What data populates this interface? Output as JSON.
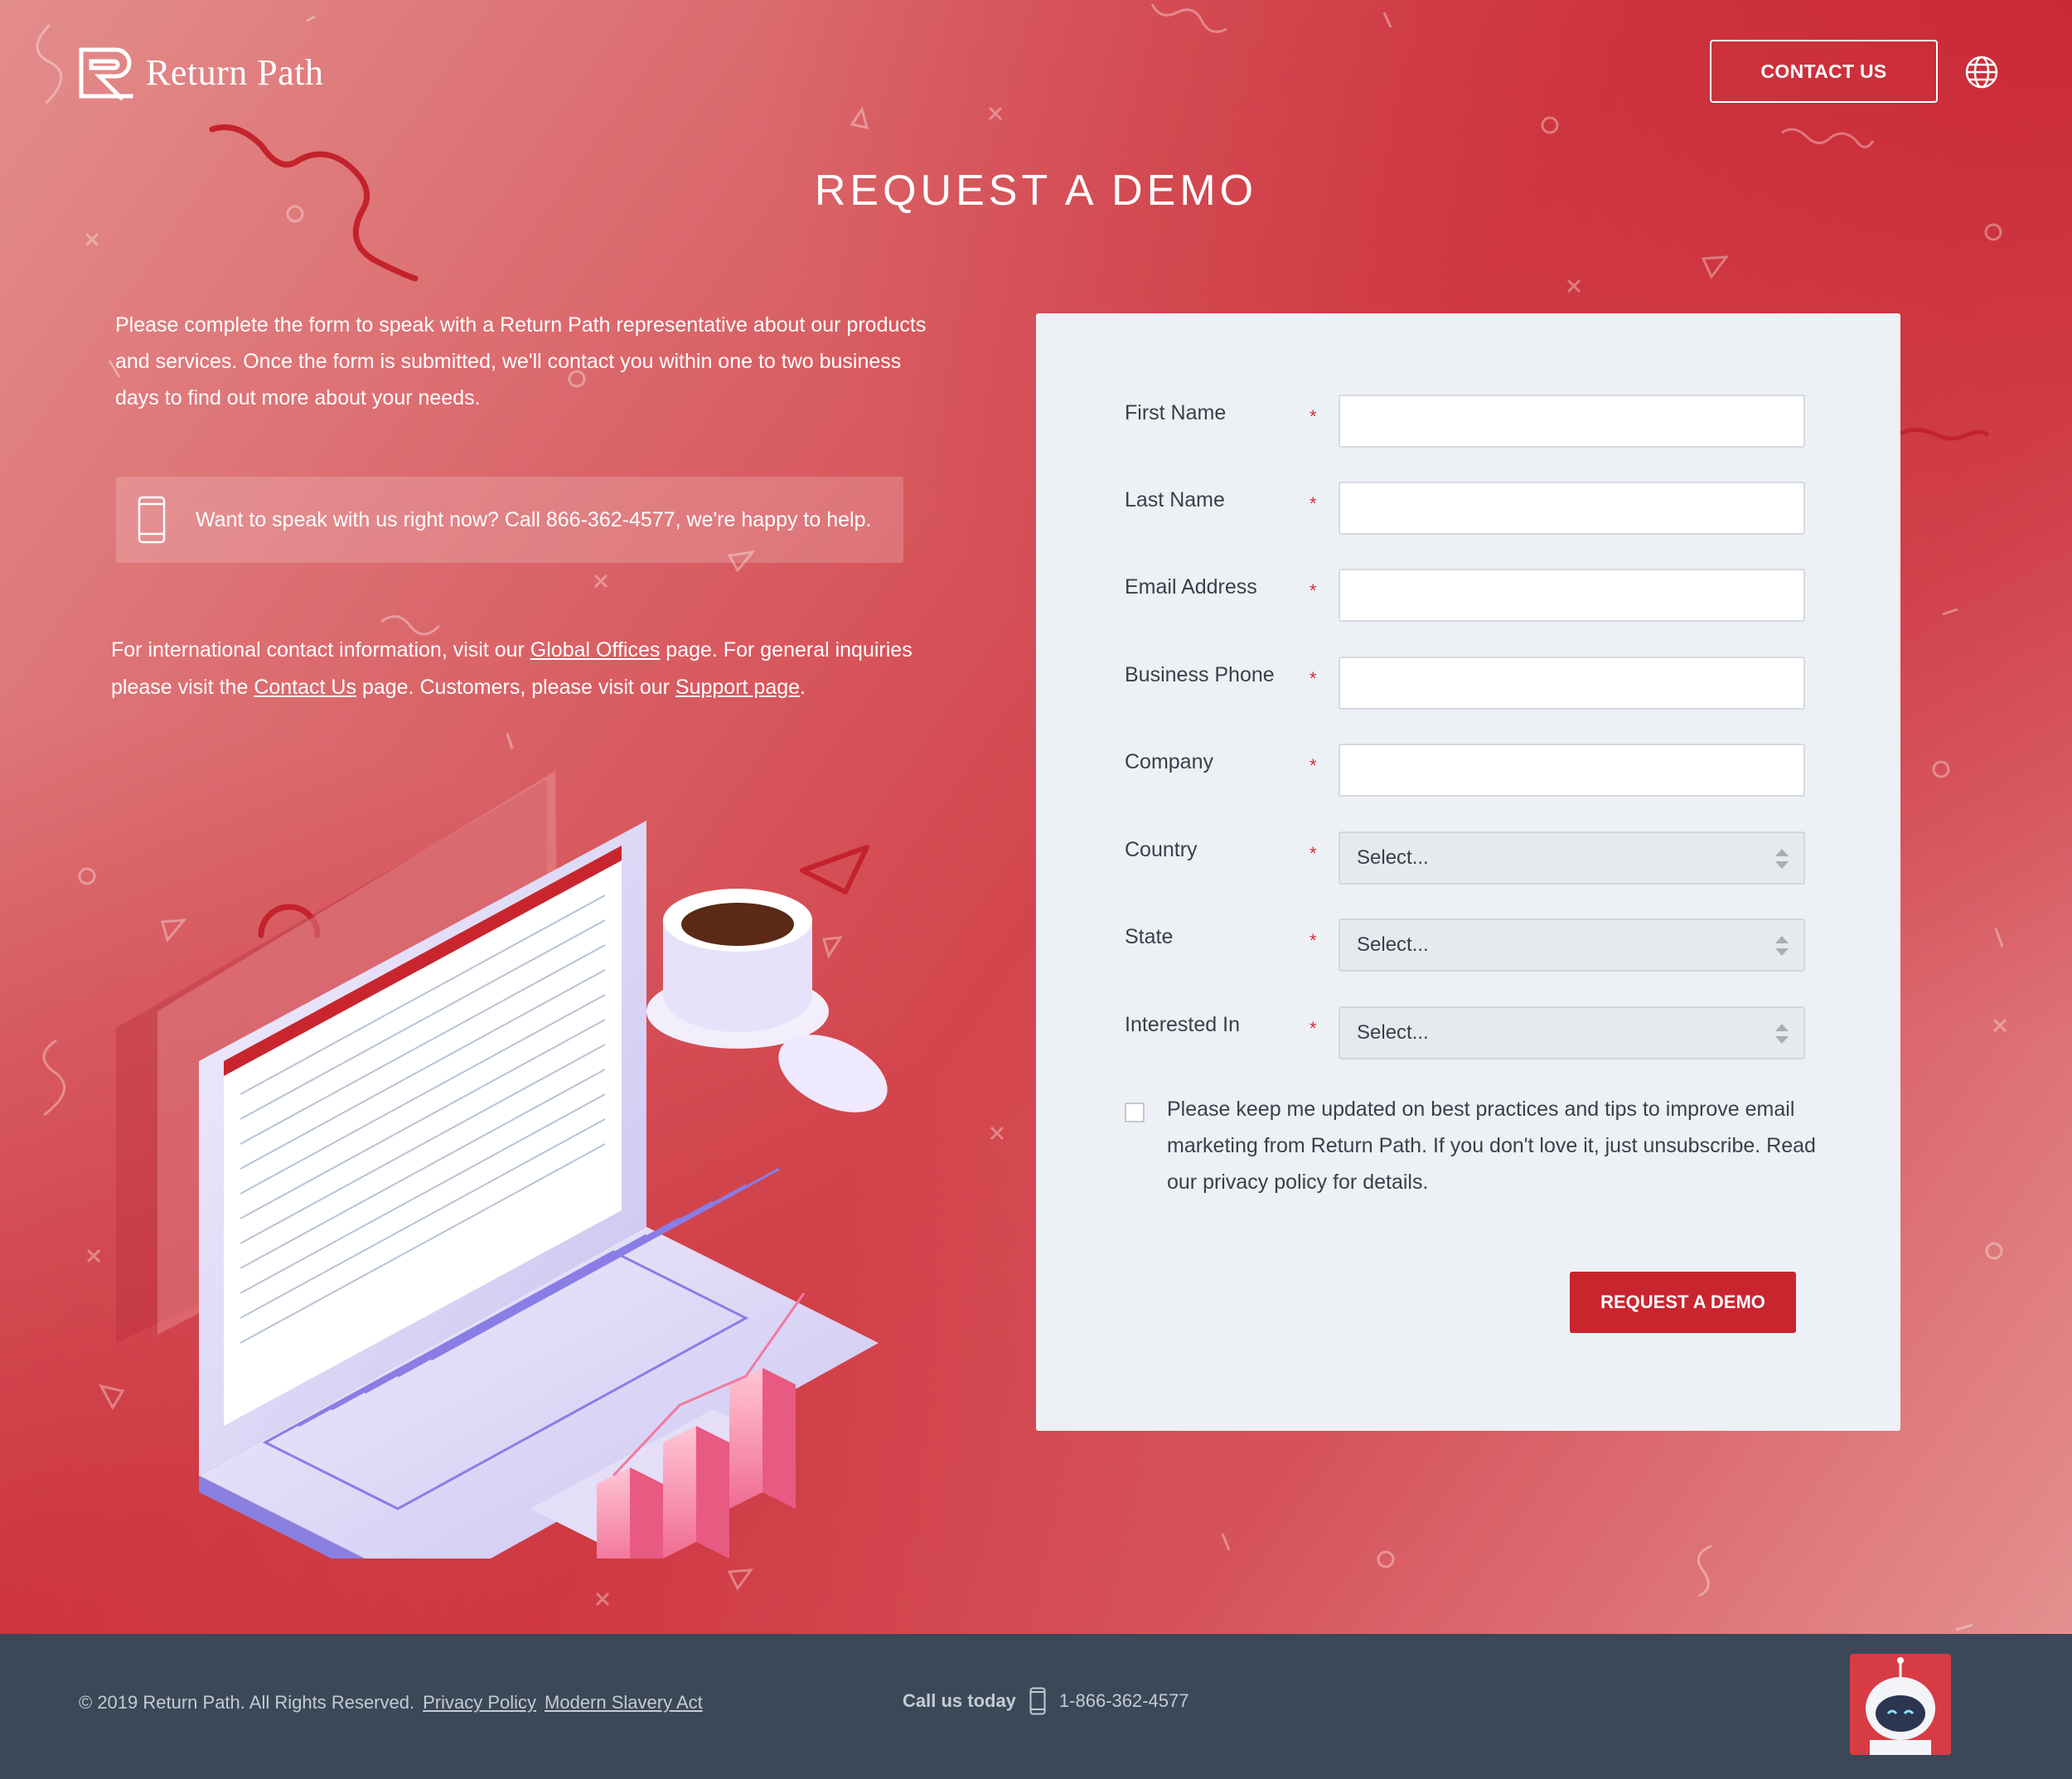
{
  "brand": {
    "name": "Return Path",
    "primary_color": "#c9252f",
    "footer_color": "#3b4858"
  },
  "header": {
    "contact_label": "CONTACT US",
    "globe_icon": "globe-icon"
  },
  "page": {
    "title": "REQUEST A DEMO",
    "intro": "Please complete the form to speak with a Return Path representative about our products and services. Once the form is submitted, we'll contact you within one to two business days to find out more about your needs.",
    "callout": "Want to speak with us right now? Call 866-362-4577, we're happy to help.",
    "intl": {
      "part1": "For international contact information, visit our ",
      "global_offices": "Global Offices",
      "part2": " page. For general inquiries please visit the ",
      "contact_us": "Contact Us",
      "part3": " page. Customers, please visit our ",
      "support": "Support page",
      "part4": "."
    }
  },
  "form": {
    "first_name": "First Name",
    "last_name": "Last Name",
    "email": "Email Address",
    "phone": "Business Phone",
    "company": "Company",
    "country": "Country",
    "state": "State",
    "interested_in": "Interested In",
    "required_mark": "*",
    "select_placeholder": "Select...",
    "consent": "Please keep me updated on best practices and tips to improve email marketing from Return Path. If you don't love it, just unsubscribe. Read our privacy policy for details.",
    "submit": "REQUEST A DEMO"
  },
  "footer": {
    "copyright": "© 2019 Return Path. All Rights Reserved.",
    "privacy": "Privacy Policy",
    "slavery": "Modern Slavery Act",
    "call_label": "Call us today",
    "phone": "1-866-362-4577"
  }
}
